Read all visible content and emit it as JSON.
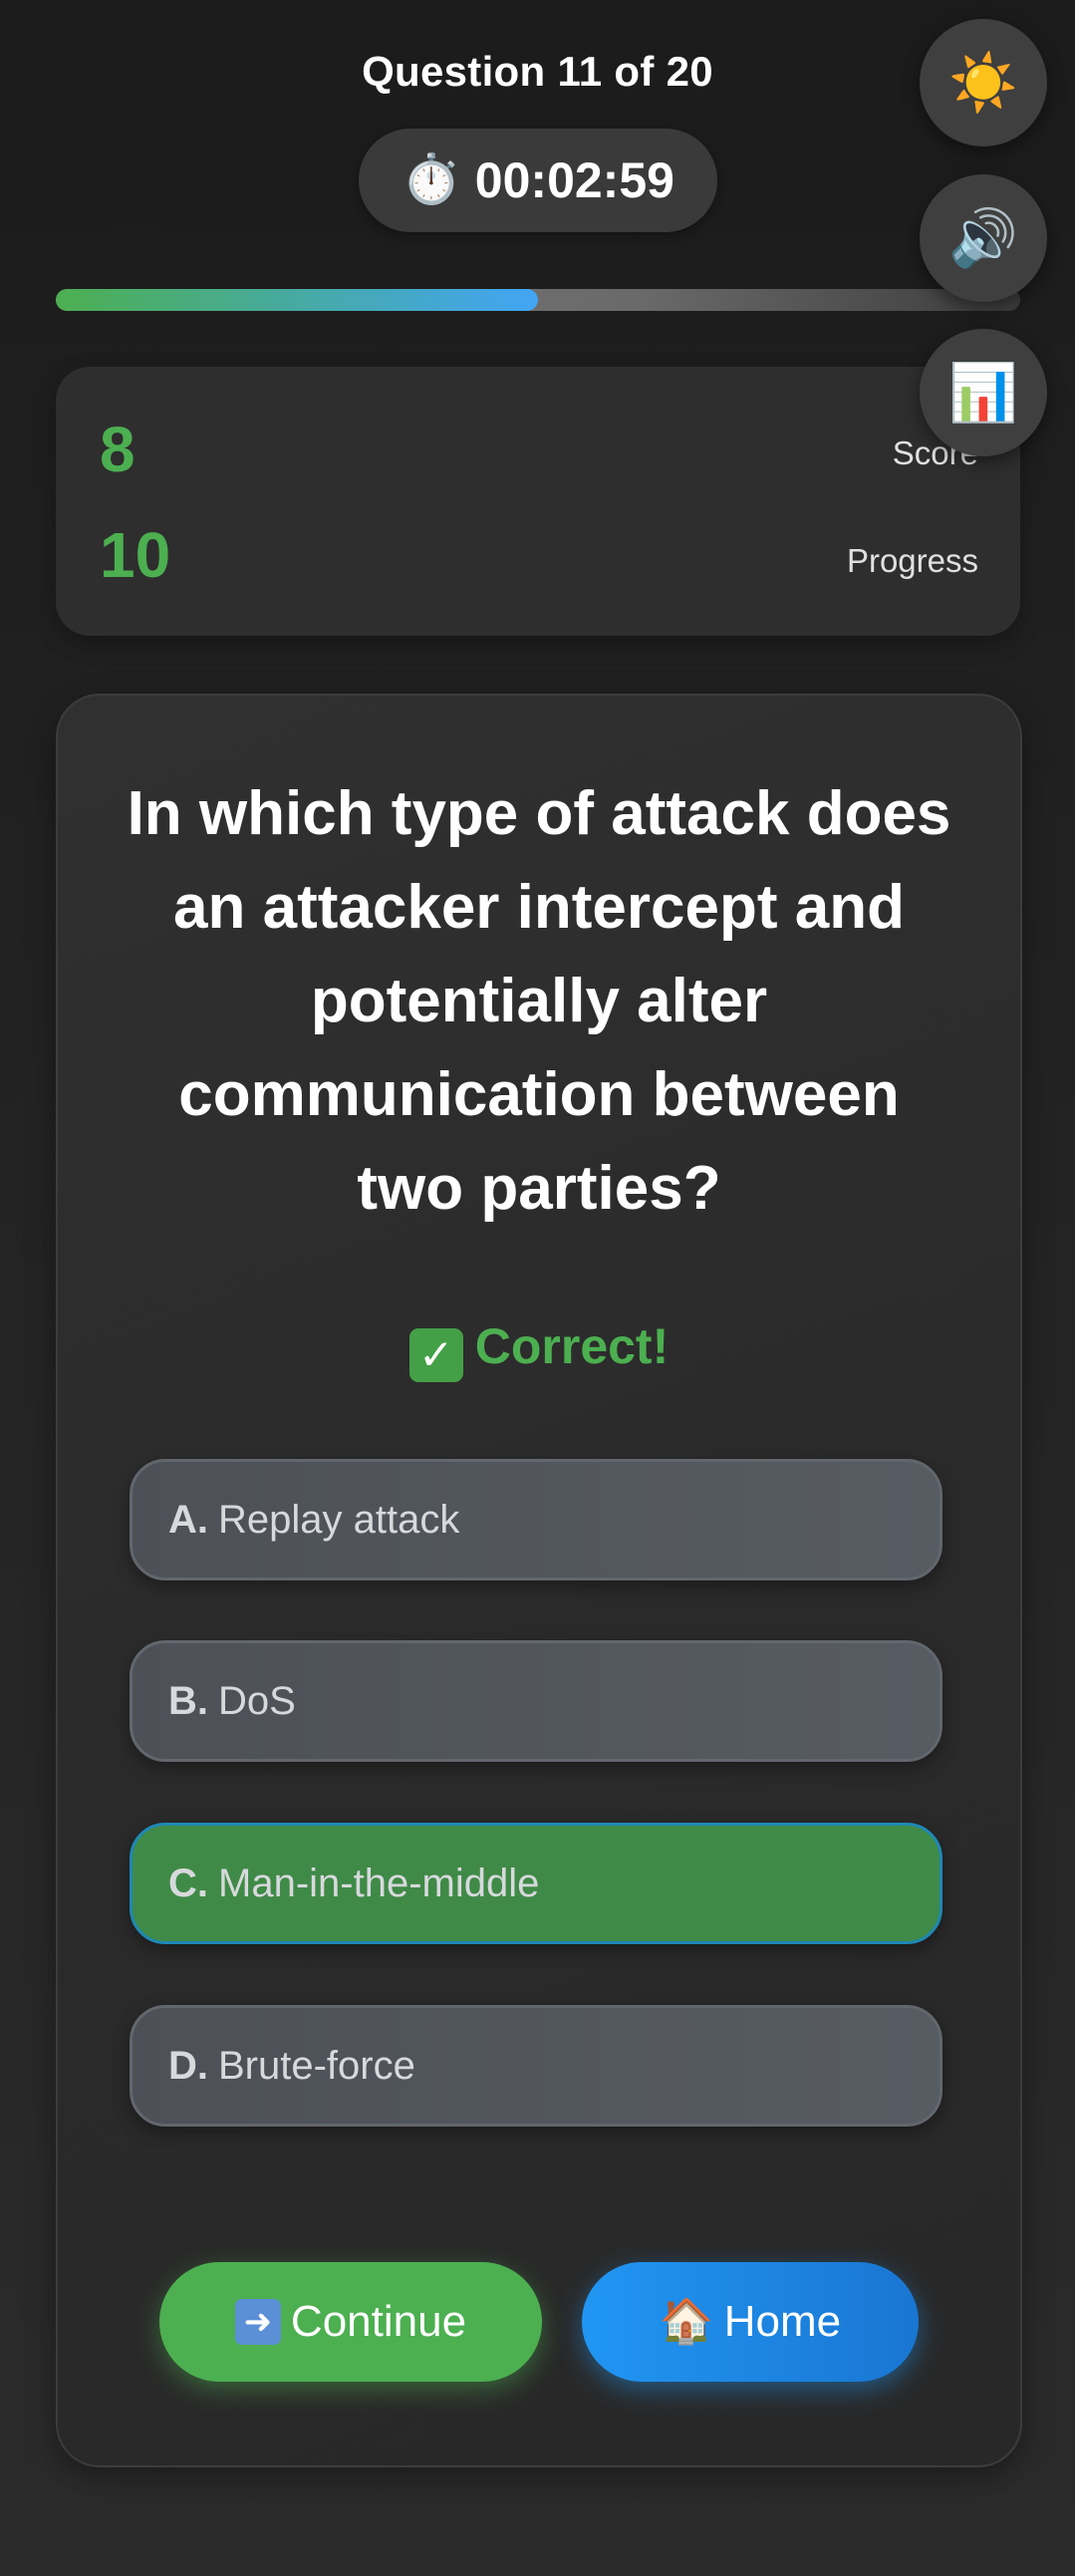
{
  "header": {
    "question_counter": "Question 11 of 20",
    "timer": "00:02:59",
    "timer_icon": "stopwatch-icon",
    "progress_fraction": 0.5
  },
  "side_buttons": {
    "theme_icon": "sun-icon",
    "sound_icon": "speaker-icon",
    "stats_icon": "bar-chart-icon"
  },
  "stats": {
    "score_value": "8",
    "score_label": "Score",
    "progress_value": "10",
    "progress_label": "Progress"
  },
  "question": {
    "text": "In which type of attack does an attacker intercept and potentially alter communication between two parties?",
    "feedback": "Correct!",
    "feedback_icon": "check-mark-icon"
  },
  "options": [
    {
      "letter": "A.",
      "text": "Replay attack",
      "state": "default"
    },
    {
      "letter": "B.",
      "text": "DoS",
      "state": "default"
    },
    {
      "letter": "C.",
      "text": "Man-in-the-middle",
      "state": "correct"
    },
    {
      "letter": "D.",
      "text": "Brute-force",
      "state": "default"
    }
  ],
  "actions": {
    "continue_label": "Continue",
    "continue_icon": "right-arrow-icon",
    "home_label": "Home",
    "home_icon": "house-icon"
  },
  "colors": {
    "accent_green": "#4caf50",
    "accent_blue": "#2196f3",
    "background": "#1f1f1f"
  }
}
